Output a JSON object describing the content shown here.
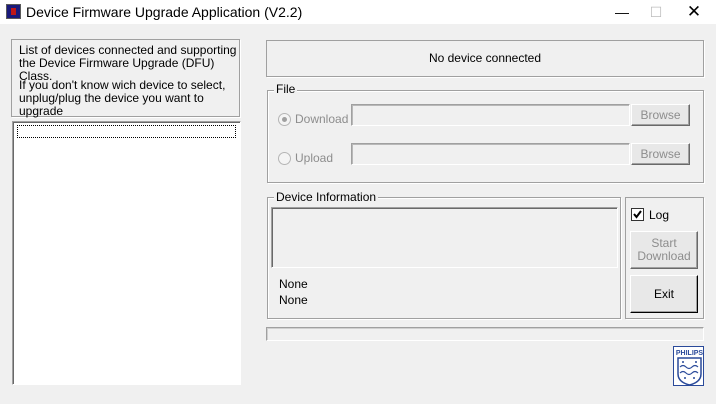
{
  "window": {
    "title": "Device Firmware Upgrade Application (V2.2)",
    "min_glyph": "—",
    "max_glyph": "☐",
    "close_glyph": "✕"
  },
  "info": {
    "line1": "List of devices connected and supporting the Device Firmware Upgrade (DFU) Class.",
    "line2": "If you don't know wich device to select, unplug/plug the device you want to upgrade"
  },
  "device_list": {
    "items": []
  },
  "status": {
    "text": "No device connected"
  },
  "file": {
    "group_label": "File",
    "download_label": "Download",
    "upload_label": "Upload",
    "browse_label": "Browse",
    "selected_mode": "Download",
    "download_path": "",
    "upload_path": ""
  },
  "device_info": {
    "group_label": "Device Information",
    "line1": "None",
    "line2": "None"
  },
  "actions": {
    "log_label": "Log",
    "log_checked": true,
    "start_line1": "Start",
    "start_line2": "Download",
    "exit_label": "Exit"
  },
  "progress": {
    "value": 0
  },
  "logo": {
    "brand": "PHILIPS"
  },
  "colors": {
    "window_bg": "#f0f0f0",
    "disabled_text": "#8d8d8d",
    "logo_blue": "#2a4a9a"
  }
}
